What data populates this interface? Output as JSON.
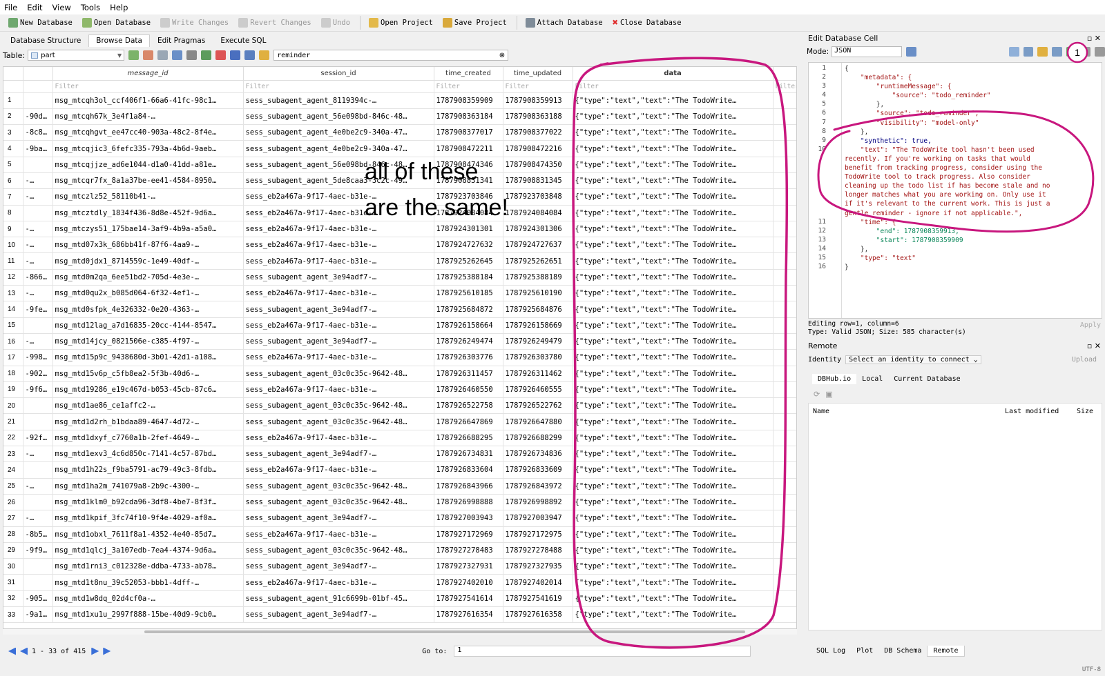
{
  "menu": [
    "File",
    "Edit",
    "View",
    "Tools",
    "Help"
  ],
  "toolbar": {
    "new_db": "New Database",
    "open_db": "Open Database",
    "write": "Write Changes",
    "revert": "Revert Changes",
    "undo": "Undo",
    "open_project": "Open Project",
    "save_project": "Save Project",
    "attach": "Attach Database",
    "close": "Close Database"
  },
  "tabs": [
    "Database Structure",
    "Browse Data",
    "Edit Pragmas",
    "Execute SQL"
  ],
  "table_label": "Table:",
  "table_name": "part",
  "filter_value": "reminder",
  "columns": [
    "message_id",
    "session_id",
    "time_created",
    "time_updated",
    "data"
  ],
  "filter_placeholder": "Filter",
  "rows": [
    [
      "1",
      "",
      "msg_mtcqh3ol_ccf406f1-66a6-41fc-98c1…",
      "sess_subagent_agent_8119394c-…",
      "1787908359909",
      "1787908359913",
      "{\"type\":\"text\",\"text\":\"The TodoWrite…"
    ],
    [
      "2",
      "-90d…",
      "msg_mtcqh67k_3e4f1a84-…",
      "sess_subagent_agent_56e098bd-846c-48…",
      "1787908363184",
      "1787908363188",
      "{\"type\":\"text\",\"text\":\"The TodoWrite…"
    ],
    [
      "3",
      "-8c8…",
      "msg_mtcqhgvt_ee47cc40-903a-48c2-8f4e…",
      "sess_subagent_agent_4e0be2c9-340a-47…",
      "1787908377017",
      "1787908377022",
      "{\"type\":\"text\",\"text\":\"The TodoWrite…"
    ],
    [
      "4",
      "-9ba…",
      "msg_mtcqjic3_6fefc335-793a-4b6d-9aeb…",
      "sess_subagent_agent_4e0be2c9-340a-47…",
      "1787908472211",
      "1787908472216",
      "{\"type\":\"text\",\"text\":\"The TodoWrite…"
    ],
    [
      "5",
      "",
      "msg_mtcqjjze_ad6e1044-d1a0-41dd-a81e…",
      "sess_subagent_agent_56e098bd-846c-48…",
      "1787908474346",
      "1787908474350",
      "{\"type\":\"text\",\"text\":\"The TodoWrite…"
    ],
    [
      "6",
      "-…",
      "msg_mtcqr7fx_8a1a37be-ee41-4584-8950…",
      "sess_subagent_agent_5de8caa3-3c2c-49…",
      "1787908831341",
      "1787908831345",
      "{\"type\":\"text\",\"text\":\"The TodoWrite…"
    ],
    [
      "7",
      "-…",
      "msg_mtczlz52_58110b41-…",
      "sess_eb2a467a-9f17-4aec-b31e-…",
      "1787923703846",
      "1787923703848",
      "{\"type\":\"text\",\"text\":\"The TodoWrite…"
    ],
    [
      "8",
      "",
      "msg_mtcztdly_1834f436-8d8e-452f-9d6a…",
      "sess_eb2a467a-9f17-4aec-b31e-…",
      "1787924084084",
      "1787924084084",
      "{\"type\":\"text\",\"text\":\"The TodoWrite…"
    ],
    [
      "9",
      "-…",
      "msg_mtczys51_175bae14-3af9-4b9a-a5a0…",
      "sess_eb2a467a-9f17-4aec-b31e-…",
      "1787924301301",
      "1787924301306",
      "{\"type\":\"text\",\"text\":\"The TodoWrite…"
    ],
    [
      "10",
      "-…",
      "msg_mtd07x3k_686bb41f-87f6-4aa9-…",
      "sess_eb2a467a-9f17-4aec-b31e-…",
      "1787924727632",
      "1787924727637",
      "{\"type\":\"text\",\"text\":\"The TodoWrite…"
    ],
    [
      "11",
      "-…",
      "msg_mtd0jdx1_8714559c-1e49-40df-…",
      "sess_eb2a467a-9f17-4aec-b31e-…",
      "1787925262645",
      "1787925262651",
      "{\"type\":\"text\",\"text\":\"The TodoWrite…"
    ],
    [
      "12",
      "-866…",
      "msg_mtd0m2qa_6ee51bd2-705d-4e3e-…",
      "sess_subagent_agent_3e94adf7-…",
      "1787925388184",
      "1787925388189",
      "{\"type\":\"text\",\"text\":\"The TodoWrite…"
    ],
    [
      "13",
      "-…",
      "msg_mtd0qu2x_b085d064-6f32-4ef1-…",
      "sess_eb2a467a-9f17-4aec-b31e-…",
      "1787925610185",
      "1787925610190",
      "{\"type\":\"text\",\"text\":\"The TodoWrite…"
    ],
    [
      "14",
      "-9fe…",
      "msg_mtd0sfpk_4e326332-0e20-4363-…",
      "sess_subagent_agent_3e94adf7-…",
      "1787925684872",
      "1787925684876",
      "{\"type\":\"text\",\"text\":\"The TodoWrite…"
    ],
    [
      "15",
      "",
      "msg_mtd12lag_a7d16835-20cc-4144-8547…",
      "sess_eb2a467a-9f17-4aec-b31e-…",
      "1787926158664",
      "1787926158669",
      "{\"type\":\"text\",\"text\":\"The TodoWrite…"
    ],
    [
      "16",
      "-…",
      "msg_mtd14jcy_0821506e-c385-4f97-…",
      "sess_subagent_agent_3e94adf7-…",
      "1787926249474",
      "1787926249479",
      "{\"type\":\"text\",\"text\":\"The TodoWrite…"
    ],
    [
      "17",
      "-998…",
      "msg_mtd15p9c_9438680d-3b01-42d1-a108…",
      "sess_eb2a467a-9f17-4aec-b31e-…",
      "1787926303776",
      "1787926303780",
      "{\"type\":\"text\",\"text\":\"The TodoWrite…"
    ],
    [
      "18",
      "-902…",
      "msg_mtd15v6p_c5fb8ea2-5f3b-40d6-…",
      "sess_subagent_agent_03c0c35c-9642-48…",
      "1787926311457",
      "1787926311462",
      "{\"type\":\"text\",\"text\":\"The TodoWrite…"
    ],
    [
      "19",
      "-9f6…",
      "msg_mtd19286_e19c467d-b053-45cb-87c6…",
      "sess_eb2a467a-9f17-4aec-b31e-…",
      "1787926460550",
      "1787926460555",
      "{\"type\":\"text\",\"text\":\"The TodoWrite…"
    ],
    [
      "20",
      "",
      "msg_mtd1ae86_ce1affc2-…",
      "sess_subagent_agent_03c0c35c-9642-48…",
      "1787926522758",
      "1787926522762",
      "{\"type\":\"text\",\"text\":\"The TodoWrite…"
    ],
    [
      "21",
      "",
      "msg_mtd1d2rh_b1bdaa89-4647-4d72-…",
      "sess_subagent_agent_03c0c35c-9642-48…",
      "1787926647869",
      "1787926647880",
      "{\"type\":\"text\",\"text\":\"The TodoWrite…"
    ],
    [
      "22",
      "-92f…",
      "msg_mtd1dxyf_c7760a1b-2fef-4649-…",
      "sess_eb2a467a-9f17-4aec-b31e-…",
      "1787926688295",
      "1787926688299",
      "{\"type\":\"text\",\"text\":\"The TodoWrite…"
    ],
    [
      "23",
      "-…",
      "msg_mtd1exv3_4c6d850c-7141-4c57-87bd…",
      "sess_subagent_agent_3e94adf7-…",
      "1787926734831",
      "1787926734836",
      "{\"type\":\"text\",\"text\":\"The TodoWrite…"
    ],
    [
      "24",
      "",
      "msg_mtd1h22s_f9ba5791-ac79-49c3-8fdb…",
      "sess_eb2a467a-9f17-4aec-b31e-…",
      "1787926833604",
      "1787926833609",
      "{\"type\":\"text\",\"text\":\"The TodoWrite…"
    ],
    [
      "25",
      "-…",
      "msg_mtd1ha2m_741079a8-2b9c-4300-…",
      "sess_subagent_agent_03c0c35c-9642-48…",
      "1787926843966",
      "1787926843972",
      "{\"type\":\"text\",\"text\":\"The TodoWrite…"
    ],
    [
      "26",
      "",
      "msg_mtd1klm0_b92cda96-3df8-4be7-8f3f…",
      "sess_subagent_agent_03c0c35c-9642-48…",
      "1787926998888",
      "1787926998892",
      "{\"type\":\"text\",\"text\":\"The TodoWrite…"
    ],
    [
      "27",
      "-…",
      "msg_mtd1kpif_3fc74f10-9f4e-4029-af0a…",
      "sess_subagent_agent_3e94adf7-…",
      "1787927003943",
      "1787927003947",
      "{\"type\":\"text\",\"text\":\"The TodoWrite…"
    ],
    [
      "28",
      "-8b5…",
      "msg_mtd1obxl_7611f8a1-4352-4e40-85d7…",
      "sess_eb2a467a-9f17-4aec-b31e-…",
      "1787927172969",
      "1787927172975",
      "{\"type\":\"text\",\"text\":\"The TodoWrite…"
    ],
    [
      "29",
      "-9f9…",
      "msg_mtd1qlcj_3a107edb-7ea4-4374-9d6a…",
      "sess_subagent_agent_03c0c35c-9642-48…",
      "1787927278483",
      "1787927278488",
      "{\"type\":\"text\",\"text\":\"The TodoWrite…"
    ],
    [
      "30",
      "",
      "msg_mtd1rni3_c012328e-ddba-4733-ab78…",
      "sess_subagent_agent_3e94adf7-…",
      "1787927327931",
      "1787927327935",
      "{\"type\":\"text\",\"text\":\"The TodoWrite…"
    ],
    [
      "31",
      "",
      "msg_mtd1t8nu_39c52053-bbb1-4dff-…",
      "sess_eb2a467a-9f17-4aec-b31e-…",
      "1787927402010",
      "1787927402014",
      "{\"type\":\"text\",\"text\":\"The TodoWrite…"
    ],
    [
      "32",
      "-905…",
      "msg_mtd1w8dq_02d4cf0a-…",
      "sess_subagent_agent_91c6699b-01bf-45…",
      "1787927541614",
      "1787927541619",
      "{\"type\":\"text\",\"text\":\"The TodoWrite…"
    ],
    [
      "33",
      "-9a1…",
      "msg_mtd1xu1u_2997f888-15be-40d9-9cb0…",
      "sess_subagent_agent_3e94adf7-…",
      "1787927616354",
      "1787927616358",
      "{\"type\":\"text\",\"text\":\"The TodoWrite…"
    ]
  ],
  "nav": {
    "range": "1 - 33 of 415",
    "goto_label": "Go to:",
    "goto_value": "1"
  },
  "edit_panel": {
    "title": "Edit Database Cell",
    "mode_label": "Mode:",
    "mode_value": "JSON",
    "status": "Editing row=1, column=6",
    "status2": "Type: Valid JSON; Size: 585 character(s)",
    "apply": "Apply"
  },
  "json_lines": [
    "{",
    "    \"metadata\": {",
    "        \"runtimeMessage\": {",
    "            \"source\": \"todo_reminder\"",
    "        },",
    "        \"source\": \"todo_reminder\",",
    "        \"visibility\": \"model-only\"",
    "    },",
    "    \"synthetic\": true,",
    "    \"text\": \"The TodoWrite tool hasn't been used",
    "recently. If you're working on tasks that would",
    "benefit from tracking progress, consider using the",
    "TodoWrite tool to track progress. Also consider",
    "cleaning up the todo list if has become stale and no",
    "longer matches what you are working on. Only use it",
    "if it's relevant to the current work. This is just a",
    "gentle reminder - ignore if not applicable.\",",
    "    \"time\": {",
    "        \"end\": 1787908359913,",
    "        \"start\": 1787908359909",
    "    },",
    "    \"type\": \"text\"",
    "}"
  ],
  "line_numbers": [
    "1",
    "2",
    "3",
    "4",
    "5",
    "6",
    "7",
    "8",
    "9",
    "10",
    "",
    "",
    "",
    "",
    "",
    "",
    "",
    "11",
    "12",
    "13",
    "14",
    "15",
    "16"
  ],
  "remote": {
    "title": "Remote",
    "identity_label": "Identity",
    "identity_value": "Select an identity to connect",
    "upload": "Upload",
    "tabs": [
      "DBHub.io",
      "Local",
      "Current Database"
    ],
    "cols": [
      "Name",
      "Last modified",
      "Size"
    ]
  },
  "bottom_tabs": [
    "SQL Log",
    "Plot",
    "DB Schema",
    "Remote"
  ],
  "encoding": "UTF-8",
  "annotation": {
    "line1": "all of these",
    "line2": "are the same!",
    "badge": "1"
  },
  "colors": {
    "annotation": "#c8177e",
    "accent": "#3a6fd8"
  }
}
